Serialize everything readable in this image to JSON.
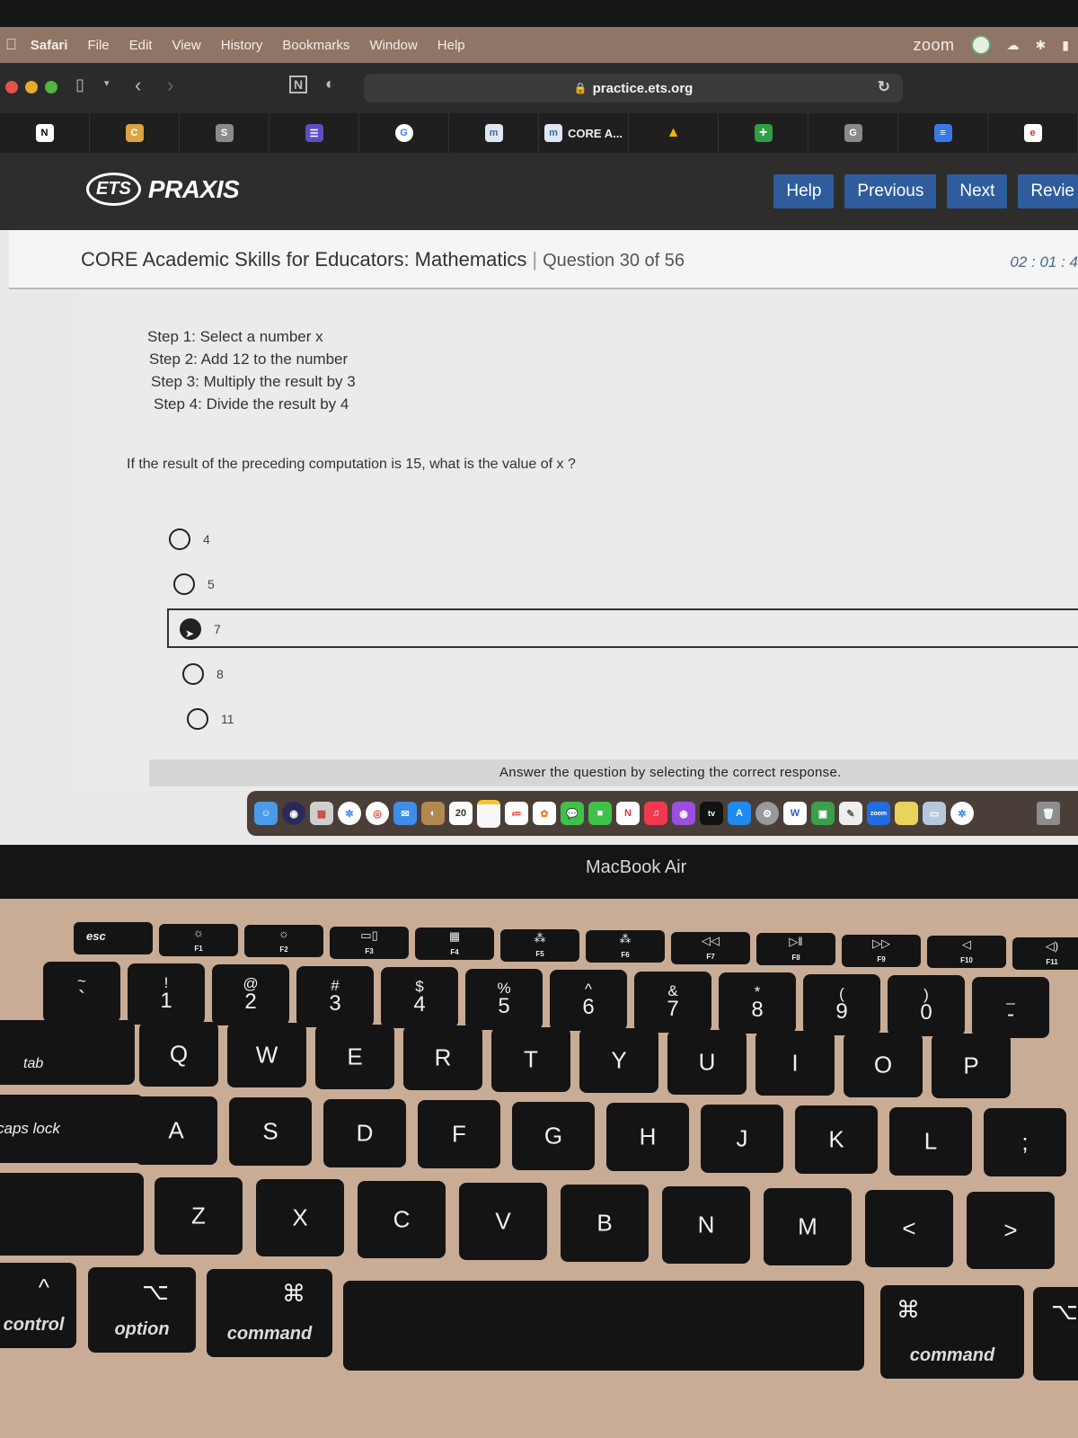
{
  "menubar": {
    "apple_icon": "apple-logo",
    "items": [
      "Safari",
      "File",
      "Edit",
      "View",
      "History",
      "Bookmarks",
      "Window",
      "Help"
    ],
    "right_app": "zoom"
  },
  "browser": {
    "url": "practice.ets.org",
    "lock_icon": "lock-icon",
    "favorites": [
      {
        "icon": "notion",
        "label": ""
      },
      {
        "icon": "cengage",
        "label": ""
      },
      {
        "icon": "s",
        "label": ""
      },
      {
        "icon": "forms",
        "label": ""
      },
      {
        "icon": "google",
        "label": ""
      },
      {
        "icon": "ets",
        "label": ""
      },
      {
        "icon": "ets",
        "label": "CORE A..."
      },
      {
        "icon": "drive",
        "label": ""
      },
      {
        "icon": "plus",
        "label": ""
      },
      {
        "icon": "g",
        "label": ""
      },
      {
        "icon": "docs",
        "label": ""
      },
      {
        "icon": "e",
        "label": ""
      }
    ]
  },
  "praxis": {
    "logo_ets": "ETS",
    "logo_praxis": "PRAXIS",
    "nav": {
      "help": "Help",
      "previous": "Previous",
      "next": "Next",
      "review": "Revie"
    }
  },
  "test": {
    "title": "CORE Academic Skills for Educators: Mathematics",
    "question_counter": "Question 30 of 56",
    "timer": "02 : 01 : 4"
  },
  "question": {
    "steps": [
      "Step 1: Select a number x",
      "Step 2: Add 12 to the number",
      "Step 3: Multiply the result by 3",
      "Step 4: Divide the result by 4"
    ],
    "prompt": "If the result of the preceding computation is 15, what is the value of x ?",
    "options": [
      {
        "label": "4",
        "selected": false
      },
      {
        "label": "5",
        "selected": false
      },
      {
        "label": "7",
        "selected": true
      },
      {
        "label": "8",
        "selected": false
      },
      {
        "label": "11",
        "selected": false
      }
    ],
    "instruction": "Answer the question by selecting the correct response."
  },
  "dock": {
    "apps": [
      "Finder",
      "Siri",
      "Launchpad",
      "Safari",
      "Chrome",
      "Mail",
      "Contacts",
      "Calendar",
      "Notes",
      "Reminders",
      "Photos",
      "Messages",
      "FaceTime",
      "News",
      "Music",
      "Podcasts",
      "TV",
      "App Store",
      "System Preferences",
      "Word",
      "Screen Share",
      "TextEdit",
      "Zoom",
      "Stickies",
      "Preview",
      "Safari Download",
      "Trash"
    ],
    "calendar_day": "20",
    "tv_label": "tv",
    "zoom_label": "zoom"
  },
  "laptop": {
    "model_label": "MacBook Air"
  },
  "keyboard": {
    "fn_row": [
      {
        "icon": "",
        "label": "esc"
      },
      {
        "icon": "☼",
        "label": "F1"
      },
      {
        "icon": "☼",
        "label": "F2"
      },
      {
        "icon": "▭▯",
        "label": "F3"
      },
      {
        "icon": "▦",
        "label": "F4"
      },
      {
        "icon": "⁂",
        "label": "F5"
      },
      {
        "icon": "⁂",
        "label": "F6"
      },
      {
        "icon": "◁◁",
        "label": "F7"
      },
      {
        "icon": "▷ǁ",
        "label": "F8"
      },
      {
        "icon": "▷▷",
        "label": "F9"
      },
      {
        "icon": "◁",
        "label": "F10"
      },
      {
        "icon": "◁)",
        "label": "F11"
      }
    ],
    "number_row": [
      {
        "top": "~",
        "main": "`"
      },
      {
        "top": "!",
        "main": "1"
      },
      {
        "top": "@",
        "main": "2"
      },
      {
        "top": "#",
        "main": "3"
      },
      {
        "top": "$",
        "main": "4"
      },
      {
        "top": "%",
        "main": "5"
      },
      {
        "top": "^",
        "main": "6"
      },
      {
        "top": "&",
        "main": "7"
      },
      {
        "top": "*",
        "main": "8"
      },
      {
        "top": "(",
        "main": "9"
      },
      {
        "top": ")",
        "main": "0"
      },
      {
        "top": "_",
        "main": "-"
      }
    ],
    "qwerty_row": [
      "tab",
      "Q",
      "W",
      "E",
      "R",
      "T",
      "Y",
      "U",
      "I",
      "O",
      "P"
    ],
    "home_row": [
      "caps lock",
      "A",
      "S",
      "D",
      "F",
      "G",
      "H",
      "J",
      "K",
      "L",
      ";"
    ],
    "bottom_row": [
      "Z",
      "X",
      "C",
      "V",
      "B",
      "N",
      "M",
      "<",
      ">"
    ],
    "modifiers": {
      "control": "control",
      "control_symbol": "^",
      "option": "option",
      "option_symbol": "⌥",
      "command": "command",
      "command_symbol": "⌘",
      "right_command": "command",
      "right_command_symbol": "⌘"
    }
  }
}
